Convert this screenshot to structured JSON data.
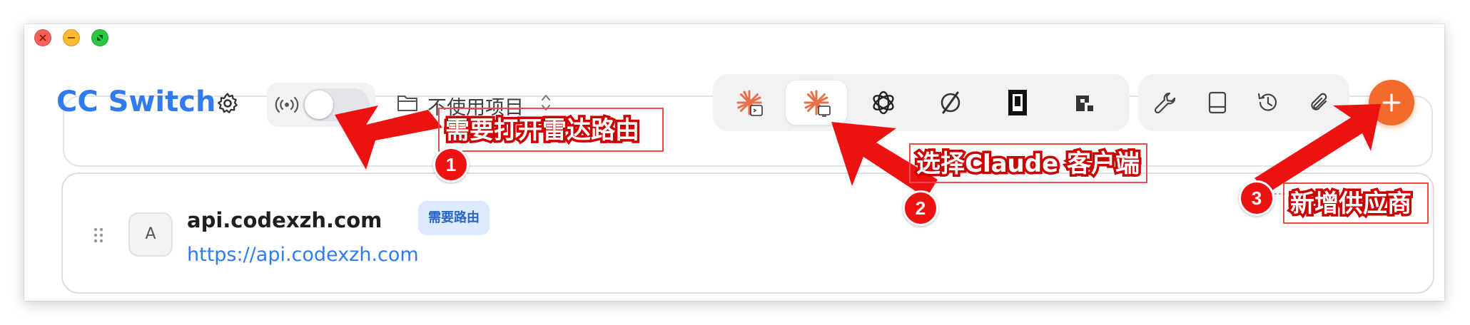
{
  "header": {
    "app_title": "CC Switch",
    "project": {
      "label": "不使用项目"
    },
    "proxy_toggle": {
      "on": false
    },
    "apps": [
      {
        "name": "claude-code-icon",
        "active": false
      },
      {
        "name": "claude-desktop-icon",
        "active": true
      },
      {
        "name": "openai-icon",
        "active": false
      },
      {
        "name": "gemini-icon",
        "active": false
      },
      {
        "name": "cursor-icon",
        "active": false
      },
      {
        "name": "app-logo-icon",
        "active": false
      }
    ],
    "tools": [
      "wrench-icon",
      "book-icon",
      "history-icon",
      "paperclip-icon"
    ]
  },
  "provider": {
    "avatar_letter": "A",
    "name": "api.codexzh.com",
    "badge": "需要路由",
    "url": "https://api.codexzh.com"
  },
  "annotations": [
    {
      "num": "1",
      "text": "需要打开雷达路由"
    },
    {
      "num": "2",
      "text": "选择Claude 客户端"
    },
    {
      "num": "3",
      "text": "新增供应商"
    }
  ],
  "colors": {
    "accent": "#2f7bef",
    "add_button": "#f26b2c",
    "annotation_red": "#ee1111",
    "claude_orange": "#e8704a"
  }
}
